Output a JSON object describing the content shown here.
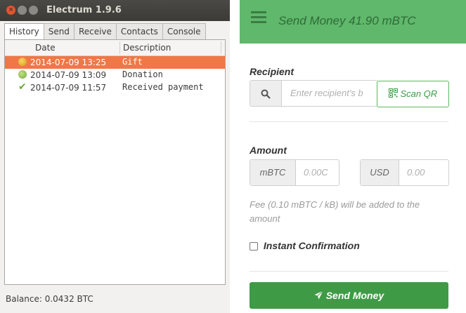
{
  "electrum": {
    "window_title": "Electrum 1.9.6",
    "tabs": [
      {
        "label": "History"
      },
      {
        "label": "Send"
      },
      {
        "label": "Receive"
      },
      {
        "label": "Contacts"
      },
      {
        "label": "Console"
      }
    ],
    "active_tab": "History",
    "columns": {
      "date": "Date",
      "description": "Description"
    },
    "rows": [
      {
        "date": "2014-07-09 13:25",
        "description": "Gift",
        "status_icon": "pending-clock-icon",
        "selected": true
      },
      {
        "date": "2014-07-09 13:09",
        "description": "Donation",
        "status_icon": "partial-clock-icon",
        "selected": false
      },
      {
        "date": "2014-07-09 11:57",
        "description": "Received payment",
        "status_icon": "confirmed-check-icon",
        "selected": false
      }
    ],
    "balance": "Balance: 0.0432 BTC",
    "colors": {
      "selection": "#f07746",
      "titlebar": "#3c3b37",
      "close_button": "#e2562d"
    }
  },
  "mobile": {
    "header_title": "Send Money 41.90 mBTC",
    "menu_icon": "hamburger-icon",
    "recipient_label": "Recipient",
    "recipient_placeholder": "Enter recipient's b",
    "search_icon": "search-icon",
    "scan_qr_label": "Scan QR",
    "qr_icon": "qr-code-icon",
    "amount_label": "Amount",
    "btc_unit": "mBTC",
    "btc_placeholder": "0.00C",
    "fiat_unit": "USD",
    "fiat_placeholder": "0.00",
    "fee_text": "Fee (0.10 mBTC / kB) will be added to the amount",
    "instant_label": "Instant Confirmation",
    "instant_checked": false,
    "send_button_label": "Send Money",
    "send_icon": "paper-plane-icon",
    "colors": {
      "header": "#5fb86b",
      "primary_button": "#3f9a46",
      "scan_border": "#5cb85c"
    }
  }
}
